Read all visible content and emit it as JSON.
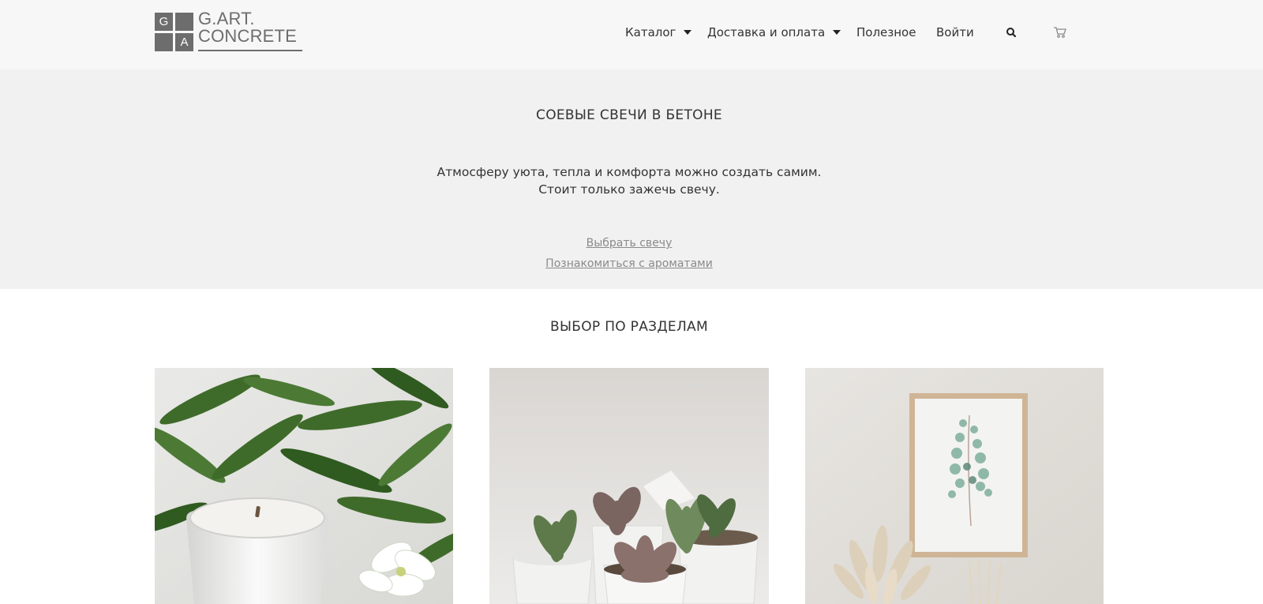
{
  "header": {
    "logo": {
      "letters": [
        "G",
        "A"
      ],
      "line1": "G.ART.",
      "line2": "CONCRETE"
    },
    "nav": [
      {
        "label": "Каталог",
        "has_dropdown": true
      },
      {
        "label": "Доставка и оплата",
        "has_dropdown": true
      },
      {
        "label": "Полезное",
        "has_dropdown": false
      },
      {
        "label": "Войти",
        "has_dropdown": false
      }
    ],
    "icons": [
      "search-icon",
      "cart-icon"
    ]
  },
  "hero": {
    "title": "СОЕВЫЕ СВЕЧИ В БЕТОНЕ",
    "text_line1": "Атмосферу уюта, тепла и комфорта можно создать самим.",
    "text_line2": "Стоит только зажечь свечу.",
    "link1": "Выбрать свечу",
    "link2": "Познакомиться с ароматами"
  },
  "sections": {
    "title": "ВЫБОР ПО РАЗДЕЛАМ",
    "cards": [
      {
        "name": "candle-image"
      },
      {
        "name": "succulents-image"
      },
      {
        "name": "framed-eucalyptus-image"
      }
    ]
  },
  "colors": {
    "header_bg": "#f7f7f7",
    "hero_bg": "#f1f1f1",
    "logo_gray": "#6d6d6d",
    "link_gray": "#8a8a8a",
    "text": "#333333"
  }
}
